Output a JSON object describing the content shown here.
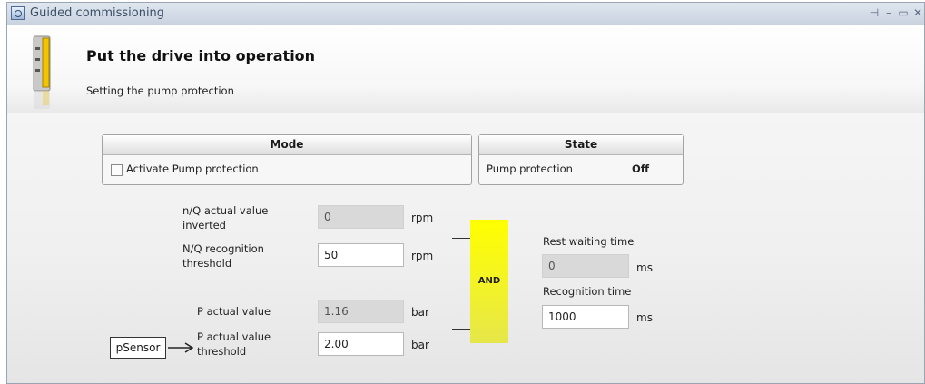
{
  "window": {
    "title": "Guided commissioning"
  },
  "header": {
    "title": "Put the drive into operation",
    "subtitle": "Setting the pump protection"
  },
  "mode": {
    "title": "Mode",
    "checkbox_label": "Activate Pump protection",
    "checked": false
  },
  "state": {
    "title": "State",
    "label": "Pump protection",
    "value": "Off"
  },
  "inputs": {
    "nq_actual": {
      "label": "n/Q actual value inverted",
      "value": "0",
      "unit": "rpm"
    },
    "nq_threshold": {
      "label": "N/Q recognition threshold",
      "value": "50",
      "unit": "rpm"
    },
    "p_actual": {
      "label": "P actual value",
      "value": "1.16",
      "unit": "bar"
    },
    "p_threshold": {
      "label": "P actual value threshold",
      "value": "2.00",
      "unit": "bar"
    }
  },
  "logic": {
    "gate_label": "AND"
  },
  "outputs": {
    "rest_waiting": {
      "label": "Rest waiting time",
      "value": "0",
      "unit": "ms"
    },
    "recognition": {
      "label": "Recognition time",
      "value": "1000",
      "unit": "ms"
    }
  },
  "sensor": {
    "label": "pSensor"
  }
}
